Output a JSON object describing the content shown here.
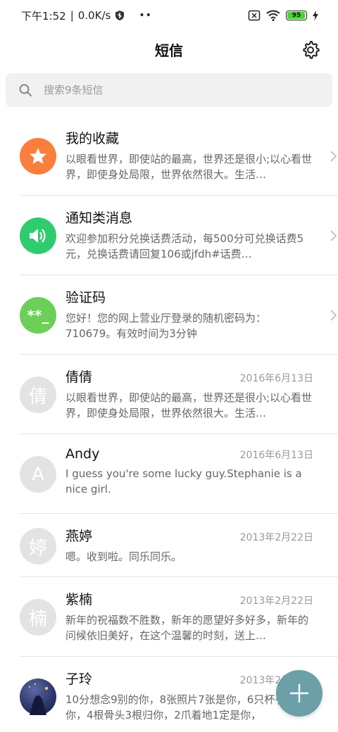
{
  "status_bar": {
    "time": "下午1:52",
    "separator": "|",
    "speed": "0.0K/s",
    "dots": "••",
    "battery": "95"
  },
  "header": {
    "title": "短信"
  },
  "search": {
    "placeholder": "搜索9条短信"
  },
  "conversations": [
    {
      "name": "我的收藏",
      "date": "",
      "preview": "以眼看世界，即使站的最高，世界还是很小;以心看世界，即使身处局限，世界依然很大。生活…",
      "avatar_text": "★",
      "avatar_color": "#fa7e3c",
      "chevron": true
    },
    {
      "name": "通知类消息",
      "date": "",
      "preview": "欢迎参加积分兑换话费活动，每500分可兑换话费5元，兑换话费请回复106或jfdh#话费…",
      "avatar_text": "",
      "avatar_color": "#2ecc6f",
      "chevron": true
    },
    {
      "name": "验证码",
      "date": "",
      "preview": "您好！您的网上营业厅登录的随机密码为：710679。有效时间为3分钟",
      "avatar_text": "**_",
      "avatar_color": "#6ccf58",
      "chevron": true
    },
    {
      "name": "倩倩",
      "date": "2016年6月13日",
      "preview": "以眼看世界，即使站的最高，世界还是很小;以心看世界，即使身处局限，世界依然很大。生活…",
      "avatar_text": "倩",
      "avatar_color": "#e3e3e3",
      "chevron": false
    },
    {
      "name": "Andy",
      "date": "2016年6月13日",
      "preview": "I guess you're some lucky guy.Stephanie is a nice girl.",
      "avatar_text": "A",
      "avatar_color": "#e3e3e3",
      "chevron": false
    },
    {
      "name": "燕婷",
      "date": "2013年2月22日",
      "preview": "嗯。收到啦。同乐同乐。",
      "avatar_text": "婷",
      "avatar_color": "#e3e3e3",
      "chevron": false
    },
    {
      "name": "紫楠",
      "date": "2013年2月22日",
      "preview": "新年的祝福数不胜数，新年的愿望好多好多，新年的问候依旧美好，在这个温馨的时刻，送上…",
      "avatar_text": "楠",
      "avatar_color": "#e3e3e3",
      "chevron": false
    },
    {
      "name": "子玲",
      "date": "2013年2月22日",
      "preview": "10分想念9别的你，8张照片7张是你，6只杯子5只像你，4根骨头3根归你，2爪着地1定是你，",
      "avatar_text": "",
      "avatar_color": "#2b3466",
      "chevron": false
    }
  ],
  "fab": {
    "label": "+"
  }
}
